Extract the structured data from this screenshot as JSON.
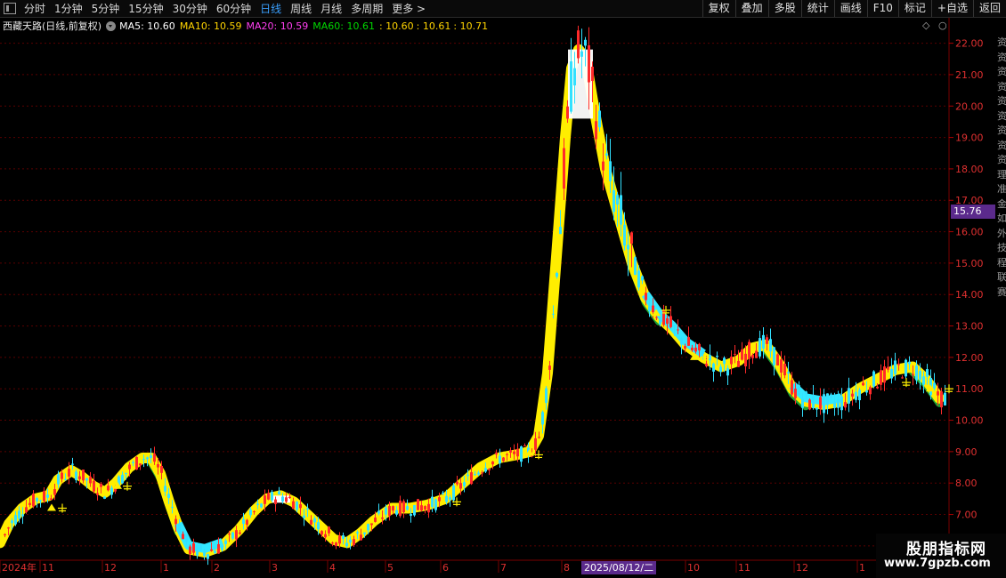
{
  "toolbar": {
    "periods": [
      "分时",
      "1分钟",
      "5分钟",
      "15分钟",
      "30分钟",
      "60分钟",
      "日线",
      "周线",
      "月线",
      "多周期",
      "更多 >"
    ],
    "active": "日线",
    "right_buttons": [
      "复权",
      "叠加",
      "多股",
      "统计",
      "画线",
      "F10",
      "标记",
      "+自选",
      "返回"
    ]
  },
  "info": {
    "title": "西藏天路(日线,前复权)",
    "ma5": "MA5: 10.60",
    "ma10": "MA10: 10.59",
    "ma20": "MA20: 10.59",
    "ma60": "MA60: 10.61",
    "extra1": ": 10.60",
    "extra2": ": 10.61",
    "extra3": ": 10.71"
  },
  "corner_icons": [
    "diamond-icon",
    "circle-icon"
  ],
  "price_badge": "15.76",
  "date_badge": "2025/08/12/二",
  "side_text": "资资资资资资资资资理准金如外技程联赛",
  "watermark": {
    "line1": "股朋指标网",
    "line2": "www.7gpzb.com"
  },
  "colors": {
    "up": "#ff2a2a",
    "down": "#33e0ff",
    "band": "#ffee00",
    "band_down": "#33e8ff",
    "green_band": "#22c040",
    "grid": "#5a0000"
  },
  "chart_data": {
    "type": "candlestick",
    "y_ticks": [
      "22.00",
      "21.00",
      "20.00",
      "19.00",
      "18.00",
      "17.00",
      "16.00",
      "15.00",
      "14.00",
      "13.00",
      "12.00",
      "11.00",
      "10.00",
      "9.00",
      "8.00",
      "7.00",
      "6.00"
    ],
    "ylim": [
      5.6,
      22.3
    ],
    "x_labels": [
      "2024年",
      "11",
      "12",
      "1",
      "2",
      "3",
      "4",
      "5",
      "6",
      "7",
      "8",
      "9",
      "10",
      "11",
      "12",
      "1"
    ],
    "band_points": [
      [
        0,
        6.1
      ],
      [
        10,
        6.7
      ],
      [
        25,
        7.2
      ],
      [
        40,
        7.5
      ],
      [
        55,
        7.6
      ],
      [
        65,
        8.1
      ],
      [
        80,
        8.4
      ],
      [
        92,
        8.2
      ],
      [
        105,
        7.9
      ],
      [
        118,
        7.7
      ],
      [
        130,
        8.0
      ],
      [
        145,
        8.5
      ],
      [
        160,
        8.8
      ],
      [
        170,
        8.8
      ],
      [
        180,
        8.3
      ],
      [
        190,
        7.4
      ],
      [
        200,
        6.6
      ],
      [
        212,
        5.9
      ],
      [
        230,
        5.8
      ],
      [
        250,
        6.0
      ],
      [
        268,
        6.5
      ],
      [
        285,
        7.1
      ],
      [
        300,
        7.5
      ],
      [
        315,
        7.6
      ],
      [
        330,
        7.4
      ],
      [
        345,
        7.0
      ],
      [
        360,
        6.6
      ],
      [
        375,
        6.2
      ],
      [
        390,
        6.1
      ],
      [
        405,
        6.4
      ],
      [
        420,
        6.8
      ],
      [
        440,
        7.2
      ],
      [
        460,
        7.2
      ],
      [
        480,
        7.3
      ],
      [
        500,
        7.5
      ],
      [
        520,
        8.0
      ],
      [
        540,
        8.5
      ],
      [
        560,
        8.8
      ],
      [
        580,
        8.9
      ],
      [
        595,
        9.0
      ],
      [
        605,
        9.5
      ],
      [
        615,
        11.5
      ],
      [
        625,
        15.2
      ],
      [
        635,
        19.0
      ],
      [
        642,
        21.2
      ],
      [
        650,
        21.8
      ],
      [
        658,
        21.5
      ],
      [
        668,
        19.8
      ],
      [
        680,
        18.0
      ],
      [
        695,
        16.5
      ],
      [
        710,
        15.0
      ],
      [
        725,
        13.9
      ],
      [
        740,
        13.3
      ],
      [
        755,
        12.9
      ],
      [
        770,
        12.4
      ],
      [
        790,
        12.0
      ],
      [
        810,
        11.7
      ],
      [
        830,
        11.9
      ],
      [
        845,
        12.3
      ],
      [
        860,
        12.4
      ],
      [
        875,
        11.8
      ],
      [
        890,
        11.0
      ],
      [
        905,
        10.6
      ],
      [
        925,
        10.5
      ],
      [
        945,
        10.6
      ],
      [
        965,
        11.0
      ],
      [
        985,
        11.3
      ],
      [
        1005,
        11.6
      ],
      [
        1025,
        11.7
      ],
      [
        1040,
        11.3
      ],
      [
        1055,
        10.7
      ]
    ]
  }
}
